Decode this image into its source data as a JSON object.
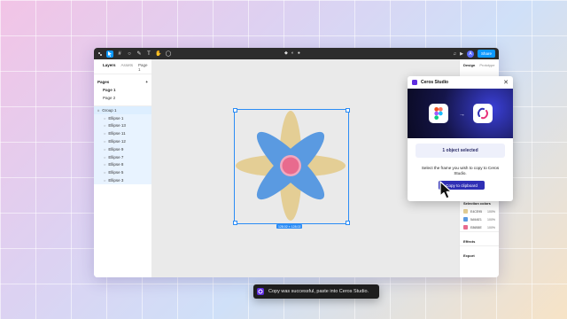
{
  "toolbar": {
    "avatar_letter": "A",
    "share_label": "Share"
  },
  "left_panel": {
    "tab_layers": "Layers",
    "tab_assets": "Assets",
    "page_selector": "Page 1",
    "pages_title": "Pages",
    "add_page": "+",
    "pages": [
      "Page 1",
      "Page 2"
    ],
    "layers": [
      {
        "name": "Group 1"
      },
      {
        "name": "Ellipse 1"
      },
      {
        "name": "Ellipse 13"
      },
      {
        "name": "Ellipse 11"
      },
      {
        "name": "Ellipse 12"
      },
      {
        "name": "Ellipse 9"
      },
      {
        "name": "Ellipse 7"
      },
      {
        "name": "Ellipse 8"
      },
      {
        "name": "Ellipse 5"
      },
      {
        "name": "Ellipse 3"
      }
    ]
  },
  "canvas": {
    "size_tag": "128.02 × 128.02",
    "colors": {
      "petal_tan": "#E4CE95",
      "petal_blue": "#5A9AE1",
      "center_pink": "#E86B8E",
      "center_ring": "#F2A7BE",
      "selection": "#2B8CF5"
    }
  },
  "right_panel": {
    "tab_design": "Design",
    "tab_prototype": "Prototype",
    "selection_colors_title": "Selection colors",
    "colors": [
      {
        "hex": "E4CE95",
        "opacity": "100%",
        "color": "#E4CE95"
      },
      {
        "hex": "5A9AE1",
        "opacity": "100%",
        "color": "#5A9AE1"
      },
      {
        "hex": "E86B8E",
        "opacity": "100%",
        "color": "#E86B8E"
      }
    ],
    "effects_title": "Effects",
    "export_title": "Export"
  },
  "plugin": {
    "title": "Ceros Studio",
    "close_symbol": "✕",
    "arrow_symbol": "→",
    "objects_selected": "1 object selected",
    "message": "Select the frame you wish to copy to Ceros Studio.",
    "copy_button": "Copy to clipboard"
  },
  "toast": {
    "message": "Copy was successful, paste into Ceros Studio."
  }
}
